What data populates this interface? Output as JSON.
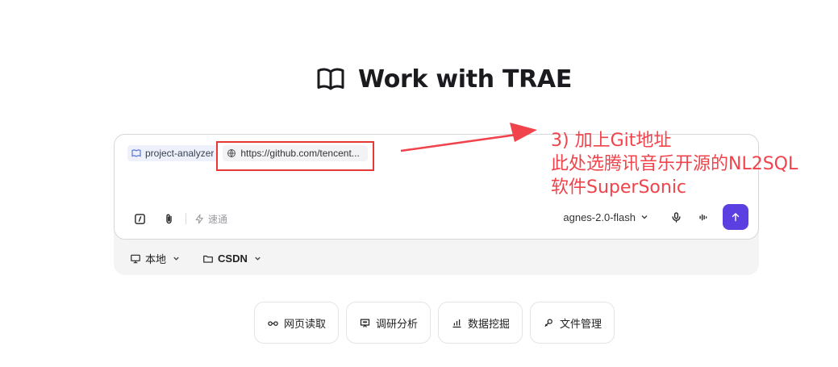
{
  "title": "Work with TRAE",
  "composer": {
    "agent_chip": "project-analyzer",
    "link_chip": "https://github.com/tencent...",
    "speed_label": "速通",
    "model_label": "agnes-2.0-flash"
  },
  "footer": {
    "env_label": "本地",
    "folder_label": "CSDN"
  },
  "quick_actions": [
    {
      "label": "网页读取",
      "icon": "glasses-icon"
    },
    {
      "label": "调研分析",
      "icon": "research-icon"
    },
    {
      "label": "数据挖掘",
      "icon": "bar-chart-icon"
    },
    {
      "label": "文件管理",
      "icon": "file-manage-icon"
    }
  ],
  "annotation": {
    "line1": "3) 加上Git地址",
    "line2": "此处选腾讯音乐开源的NL2SQL",
    "line3": "软件SuperSonic",
    "color": "#f0434b"
  },
  "colors": {
    "send_button": "#5b3fe0",
    "highlight_box": "#e53935"
  }
}
